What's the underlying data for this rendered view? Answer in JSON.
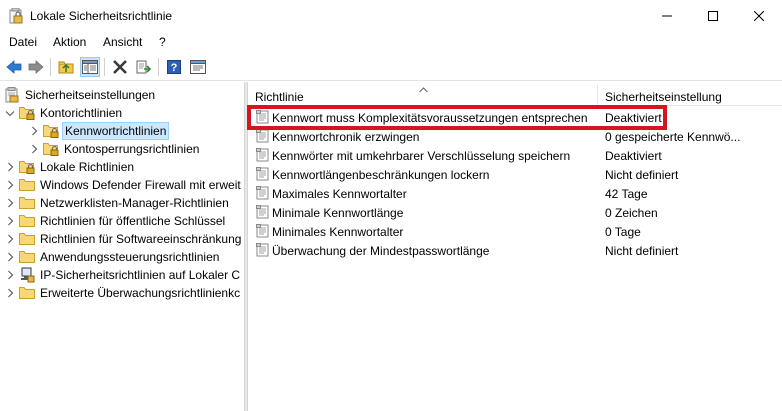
{
  "window": {
    "title": "Lokale Sicherheitsrichtlinie",
    "controls": [
      "minimize",
      "maximize",
      "close"
    ]
  },
  "menu": {
    "items": [
      "Datei",
      "Aktion",
      "Ansicht",
      "?"
    ]
  },
  "toolbar": {
    "buttons": [
      "back-arrow-icon",
      "forward-arrow-icon",
      "up-folder-icon",
      "show-hide-tree-icon",
      "delete-icon",
      "export-icon",
      "help-icon",
      "properties-icon"
    ]
  },
  "tree": {
    "items": [
      {
        "label": "Sicherheitseinstellungen",
        "level": 0,
        "expanded": true,
        "icon": "security-settings-icon"
      },
      {
        "label": "Kontorichtlinien",
        "level": 1,
        "expanded": true,
        "icon": "folder-lock-icon"
      },
      {
        "label": "Kennwortrichtlinien",
        "level": 2,
        "expanded": false,
        "icon": "folder-lock-icon",
        "selected": true
      },
      {
        "label": "Kontosperrungsrichtlinien",
        "level": 2,
        "expanded": false,
        "icon": "folder-lock-icon"
      },
      {
        "label": "Lokale Richtlinien",
        "level": 1,
        "expanded": false,
        "icon": "folder-lock-icon"
      },
      {
        "label": "Windows Defender Firewall mit erweit",
        "level": 1,
        "expanded": false,
        "icon": "folder-icon"
      },
      {
        "label": "Netzwerklisten-Manager-Richtlinien",
        "level": 1,
        "expanded": false,
        "icon": "folder-icon"
      },
      {
        "label": "Richtlinien für öffentliche Schlüssel",
        "level": 1,
        "expanded": false,
        "icon": "folder-icon"
      },
      {
        "label": "Richtlinien für Softwareeinschränkung",
        "level": 1,
        "expanded": false,
        "icon": "folder-icon"
      },
      {
        "label": "Anwendungssteuerungsrichtlinien",
        "level": 1,
        "expanded": false,
        "icon": "folder-icon"
      },
      {
        "label": "IP-Sicherheitsrichtlinien auf Lokaler C",
        "level": 1,
        "expanded": false,
        "icon": "ip-security-icon"
      },
      {
        "label": "Erweiterte Überwachungsrichtlinienkc",
        "level": 1,
        "expanded": false,
        "icon": "folder-icon"
      }
    ]
  },
  "list": {
    "columns": [
      "Richtlinie",
      "Sicherheitseinstellung"
    ],
    "rows": [
      {
        "name": "Kennwort muss Komplexitätsvoraussetzungen entsprechen",
        "value": "Deaktiviert"
      },
      {
        "name": "Kennwortchronik erzwingen",
        "value": "0 gespeicherte Kennwö..."
      },
      {
        "name": "Kennwörter mit umkehrbarer Verschlüsselung speichern",
        "value": "Deaktiviert"
      },
      {
        "name": "Kennwortlängenbeschränkungen lockern",
        "value": "Nicht definiert"
      },
      {
        "name": "Maximales Kennwortalter",
        "value": "42 Tage"
      },
      {
        "name": "Minimale Kennwortlänge",
        "value": "0 Zeichen"
      },
      {
        "name": "Minimales Kennwortalter",
        "value": "0 Tage"
      },
      {
        "name": "Überwachung der Mindestpasswortlänge",
        "value": "Nicht definiert"
      }
    ]
  },
  "colors": {
    "highlight": "#d7151e",
    "selection": "#cce8ff",
    "accent": "#0067c0"
  }
}
